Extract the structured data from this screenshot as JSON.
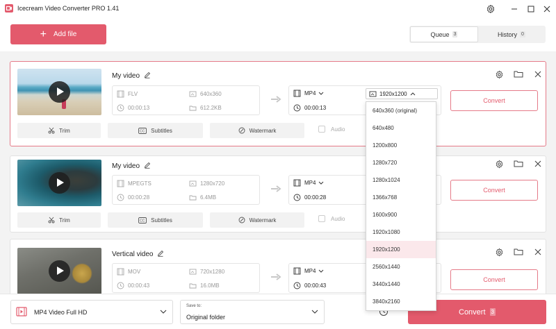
{
  "app": {
    "title": "Icecream Video Converter PRO 1.41"
  },
  "header": {
    "add_file_label": "Add file",
    "tabs": [
      {
        "label": "Queue",
        "count": "3",
        "active": true
      },
      {
        "label": "History",
        "count": "0",
        "active": false
      }
    ]
  },
  "files": [
    {
      "name": "My video",
      "format": "FLV",
      "resolution": "640x360",
      "duration": "00:00:13",
      "size": "612.2KB",
      "out_format": "MP4",
      "out_resolution": "1920x1200",
      "out_duration": "00:00:13",
      "convert_label": "Convert"
    },
    {
      "name": "My video",
      "format": "MPEGTS",
      "resolution": "1280x720",
      "duration": "00:00:28",
      "size": "6.4MB",
      "out_format": "MP4",
      "out_duration": "00:00:28",
      "convert_label": "Convert"
    },
    {
      "name": "Vertical video",
      "format": "MOV",
      "resolution": "720x1280",
      "duration": "00:00:43",
      "size": "16.0MB",
      "out_format": "MP4",
      "out_duration": "00:00:43",
      "convert_label": "Convert"
    }
  ],
  "tools": {
    "trim": "Trim",
    "subtitles": "Subtitles",
    "watermark": "Watermark",
    "audio": "Audio"
  },
  "resolution_dropdown": {
    "options": [
      "640x360 (original)",
      "640x480",
      "1200x800",
      "1280x720",
      "1280x1024",
      "1366x768",
      "1600x900",
      "1920x1080",
      "1920x1200",
      "2560x1440",
      "3440x1440",
      "3840x2160"
    ],
    "selected": "1920x1200"
  },
  "bottom": {
    "preset": "MP4 Video Full HD",
    "save_to_label": "Save to:",
    "save_to_value": "Original folder",
    "convert_all_label": "Convert",
    "convert_all_count": "3"
  },
  "colors": {
    "accent": "#e35a6c",
    "selected_border": "#e57a88",
    "highlight": "#fbe8eb"
  }
}
